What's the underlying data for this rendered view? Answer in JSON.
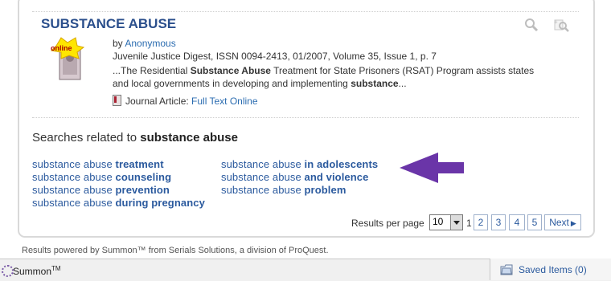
{
  "result": {
    "title": "SUBSTANCE ABUSE",
    "badge": "online",
    "by_prefix": "by",
    "author": "Anonymous",
    "citation": "Juvenile Justice Digest, ISSN 0094-2413, 01/2007, Volume 35, Issue 1, p. 7",
    "snippet_1a": "...The Residential ",
    "snippet_1b": "Substance Abuse",
    "snippet_1c": " Treatment for State Prisoners (RSAT) Program assists states",
    "snippet_2a": "and local governments in developing and implementing ",
    "snippet_2b": "substance",
    "snippet_2c": "...",
    "type": "Journal Article:",
    "fulltext_link": "Full Text Online"
  },
  "related": {
    "heading_prefix": "Searches related to ",
    "heading_query": "substance abuse",
    "items": [
      {
        "base": "substance abuse ",
        "term": "treatment"
      },
      {
        "base": "substance abuse ",
        "term": "counseling"
      },
      {
        "base": "substance abuse ",
        "term": "prevention"
      },
      {
        "base": "substance abuse ",
        "term": "during pregnancy"
      },
      {
        "base": "substance abuse ",
        "term": "in adolescents"
      },
      {
        "base": "substance abuse ",
        "term": "and violence"
      },
      {
        "base": "substance abuse ",
        "term": "problem"
      }
    ]
  },
  "pagination": {
    "results_label": "Results per page",
    "per_page": "10",
    "current": "1",
    "pages": [
      "2",
      "3",
      "4",
      "5"
    ],
    "next_label": "Next"
  },
  "footer": {
    "powered_by": "Results powered by Summon™ from Serials Solutions, a division of ProQuest.",
    "brand": "Summon",
    "brand_tm": "TM",
    "saved_items": "Saved Items (0)"
  },
  "colors": {
    "link": "#2b5a9e",
    "title": "#2b4f8c",
    "arrow": "#6a35a8",
    "badge": "#ffe600"
  },
  "icons": [
    "magnify-icon",
    "add-zoom-icon",
    "document-icon",
    "book-thumbnail-icon",
    "next-arrow-icon",
    "saved-folder-icon",
    "summon-logo-icon",
    "purple-arrow-icon"
  ]
}
